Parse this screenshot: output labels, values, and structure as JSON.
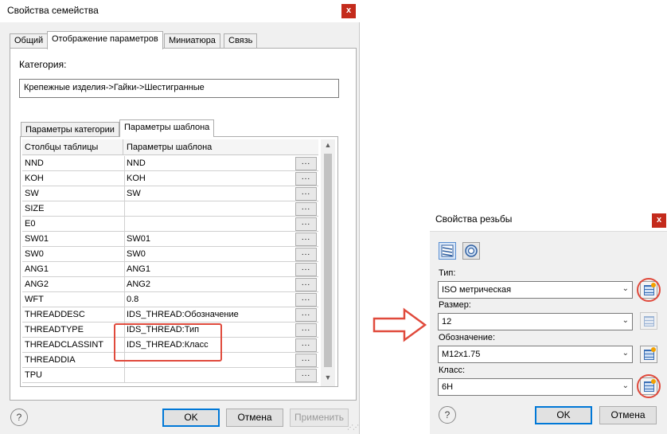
{
  "family_dialog": {
    "title": "Свойства семейства",
    "close": "x",
    "tabs": [
      "Общий",
      "Отображение параметров",
      "Миниатюра",
      "Связь"
    ],
    "category_label": "Категория:",
    "category_value": "Крепежные изделия->Гайки->Шестигранные",
    "subtabs": [
      "Параметры категории",
      "Параметры шаблона"
    ],
    "grid": {
      "columns": [
        "Столбцы таблицы",
        "Параметры шаблона"
      ],
      "ellipsis": "...",
      "rows": [
        [
          "NND",
          "NND"
        ],
        [
          "KOH",
          "KOH"
        ],
        [
          "SW",
          "SW"
        ],
        [
          "SIZE",
          ""
        ],
        [
          "E0",
          ""
        ],
        [
          "SW01",
          "SW01"
        ],
        [
          "SW0",
          "SW0"
        ],
        [
          "ANG1",
          "ANG1"
        ],
        [
          "ANG2",
          "ANG2"
        ],
        [
          "WFT",
          "0.8"
        ],
        [
          "THREADDESC",
          "IDS_THREAD:Обозначение"
        ],
        [
          "THREADTYPE",
          "IDS_THREAD:Тип"
        ],
        [
          "THREADCLASSINT",
          "IDS_THREAD:Класс"
        ],
        [
          "THREADDIA",
          ""
        ],
        [
          "TPU",
          ""
        ]
      ]
    },
    "help": "?",
    "buttons": {
      "ok": "OK",
      "cancel": "Отмена",
      "apply": "Применить"
    }
  },
  "thread_dialog": {
    "title": "Свойства резьбы",
    "close": "x",
    "type_label": "Тип:",
    "type_value": "ISO метрическая",
    "size_label": "Размер:",
    "size_value": "12",
    "designation_label": "Обозначение:",
    "designation_value": "M12x1.75",
    "class_label": "Класс:",
    "class_value": "6H",
    "help": "?",
    "buttons": {
      "ok": "OK",
      "cancel": "Отмена"
    }
  },
  "colors": {
    "highlight": "#e04a3c",
    "close": "#c42b1c",
    "primary_border": "#0078d7"
  }
}
